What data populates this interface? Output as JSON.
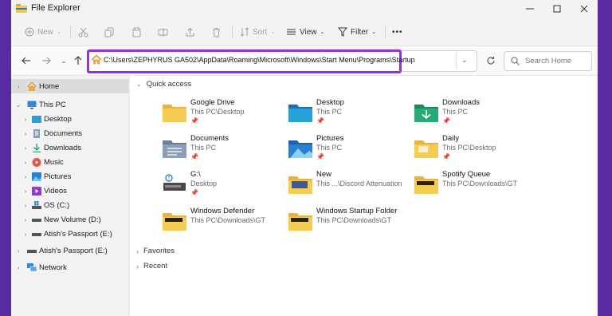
{
  "window": {
    "title": "File Explorer"
  },
  "toolbar": {
    "new_label": "New",
    "sort_label": "Sort",
    "view_label": "View",
    "filter_label": "Filter",
    "more_label": "•••"
  },
  "address": {
    "path": "C:\\Users\\ZEPHYRUS GA502\\AppData\\Roaming\\Microsoft\\Windows\\Start Menu\\Programs\\Startup",
    "highlight_color": "#9a2fd4"
  },
  "search": {
    "placeholder": "Search Home"
  },
  "sidebar": {
    "items": [
      {
        "label": "Home"
      },
      {
        "label": "This PC"
      },
      {
        "label": "Desktop"
      },
      {
        "label": "Documents"
      },
      {
        "label": "Downloads"
      },
      {
        "label": "Music"
      },
      {
        "label": "Pictures"
      },
      {
        "label": "Videos"
      },
      {
        "label": "OS (C:)"
      },
      {
        "label": "New Volume (D:)"
      },
      {
        "label": "Atish's Passport  (E:)"
      },
      {
        "label": "Atish's Passport  (E:)"
      },
      {
        "label": "Network"
      }
    ]
  },
  "content": {
    "quick_access_label": "Quick access",
    "favorites_label": "Favorites",
    "recent_label": "Recent",
    "items": [
      {
        "name": "Google Drive",
        "path": "This PC\\Desktop",
        "icon": "folder-icon"
      },
      {
        "name": "Desktop",
        "path": "This PC",
        "icon": "desktop-folder-icon"
      },
      {
        "name": "Downloads",
        "path": "This PC",
        "icon": "downloads-folder-icon"
      },
      {
        "name": "Documents",
        "path": "This PC",
        "icon": "documents-folder-icon"
      },
      {
        "name": "Pictures",
        "path": "This PC",
        "icon": "pictures-folder-icon"
      },
      {
        "name": "Daily",
        "path": "This PC\\Desktop",
        "icon": "folder-icon"
      },
      {
        "name": "G:\\",
        "path": "Desktop",
        "icon": "drive-icon"
      },
      {
        "name": "New",
        "path": "This ...\\Discord Attenuation",
        "icon": "folder-icon"
      },
      {
        "name": "Spotify Queue",
        "path": "This PC\\Downloads\\GT",
        "icon": "folder-icon"
      },
      {
        "name": "Windows Defender",
        "path": "This PC\\Downloads\\GT",
        "icon": "folder-icon"
      },
      {
        "name": "Windows Startup Folder",
        "path": "This PC\\Downloads\\GT",
        "icon": "folder-icon"
      }
    ]
  },
  "colors": {
    "background": "#5a2aa0",
    "folder": "#f3c94a",
    "accent": "#1a73c8"
  }
}
